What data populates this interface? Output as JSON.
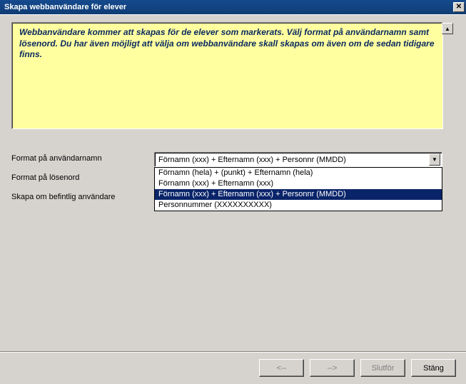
{
  "window": {
    "title": "Skapa webbanvändare för elever"
  },
  "info": {
    "text": "Webbanvändare kommer att skapas för de elever som markerats. Välj format på användarnamn samt lösenord. Du har även möjligt att välja om webbanvändare skall skapas om även om de sedan tidigare finns."
  },
  "labels": {
    "username_format": "Format på användarnamn",
    "password_format": "Format på lösenord",
    "recreate_existing": "Skapa om befintlig användare"
  },
  "select": {
    "value": "Förnamn (xxx) + Efternamn (xxx) + Personnr (MMDD)",
    "options": [
      "Förnamn (hela) + (punkt) + Efternamn (hela)",
      "Förnamn (xxx) + Efternamn (xxx)",
      "Förnamn (xxx) + Efternamn (xxx) + Personnr (MMDD)",
      "Personnummer (XXXXXXXXXX)"
    ],
    "selected_index": 2
  },
  "buttons": {
    "back": "<--",
    "next": "-->",
    "finish": "Slutför",
    "close": "Stäng"
  }
}
